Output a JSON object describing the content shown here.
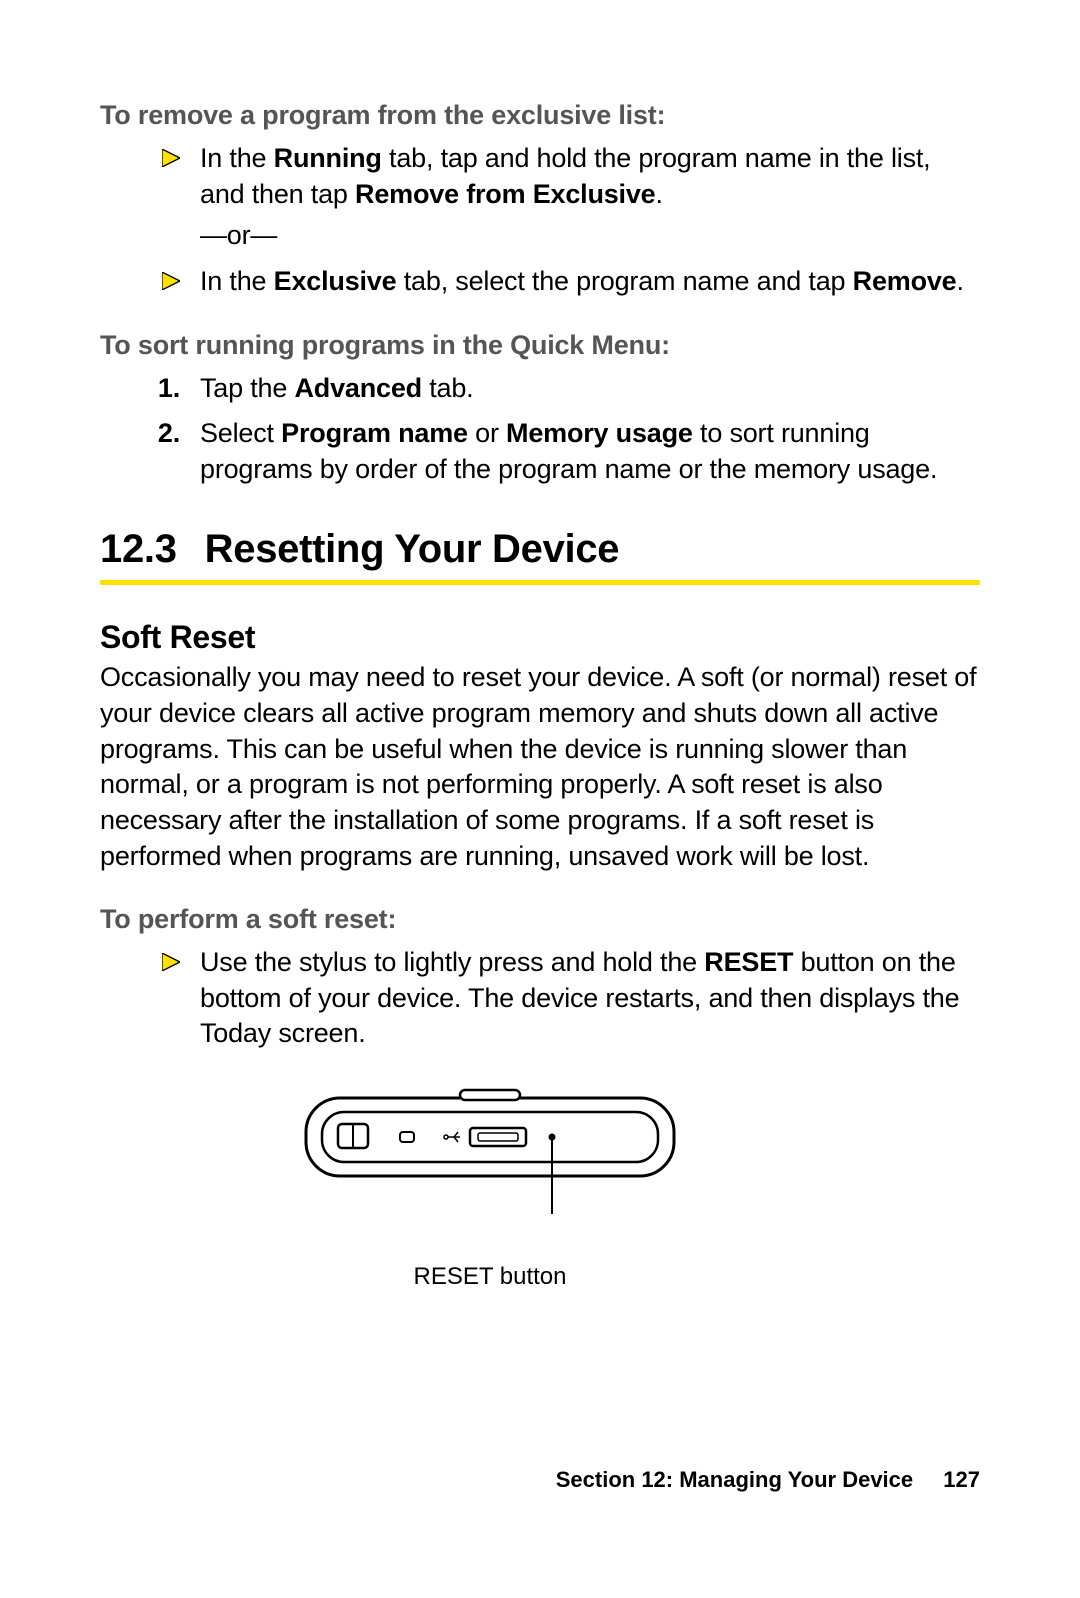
{
  "sect1": {
    "subhead": "To remove a program from the exclusive list:",
    "bullets": [
      {
        "pre": "In the ",
        "b1": "Running",
        "mid1": " tab, tap and hold the program name in the list, and then tap ",
        "b2": "Remove from Exclusive",
        "post": ".",
        "sub": "—or—"
      },
      {
        "pre": "In the ",
        "b1": "Exclusive",
        "mid1": " tab, select the program name and tap ",
        "b2": "Remove",
        "post": "."
      }
    ]
  },
  "sect2": {
    "subhead": "To sort running programs in the Quick Menu:",
    "steps": [
      {
        "num": "1.",
        "pre": "Tap the ",
        "b1": "Advanced",
        "post": " tab."
      },
      {
        "num": "2.",
        "pre": "Select ",
        "b1": "Program name",
        "mid1": " or ",
        "b2": "Memory usage",
        "post": " to sort running programs by order of the program name or the memory usage."
      }
    ]
  },
  "section_head": {
    "number": "12.3",
    "title": "Resetting Your Device"
  },
  "soft_reset": {
    "heading": "Soft Reset",
    "body": "Occasionally you may need to reset your device. A soft (or normal) reset of your device clears all active program memory and shuts down all active programs. This can be useful when the device is running slower than normal, or a program is not performing properly. A soft reset is also necessary after the installation of some programs. If a soft reset is performed when programs are running, unsaved work will be lost."
  },
  "sect3": {
    "subhead": "To perform a soft reset:",
    "bullet": {
      "pre": "Use the stylus to lightly press and hold the ",
      "b1": "RESET",
      "post": " button on the bottom of your device. The device restarts, and then displays the Today screen."
    }
  },
  "figure": {
    "caption": "RESET button"
  },
  "footer": {
    "section_label": "Section 12: Managing Your Device",
    "page": "127"
  }
}
